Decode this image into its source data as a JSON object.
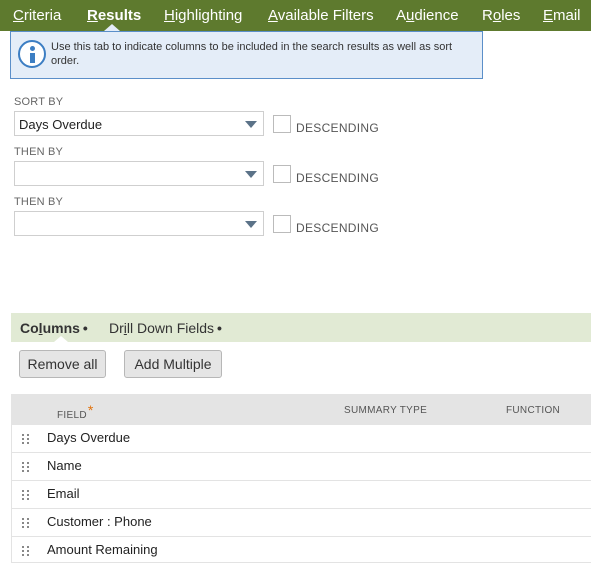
{
  "top_tabs": [
    {
      "pre": "",
      "acc": "C",
      "post": "riteria"
    },
    {
      "pre": "",
      "acc": "R",
      "post": "esults"
    },
    {
      "pre": "",
      "acc": "H",
      "post": "ighlighting"
    },
    {
      "pre": "",
      "acc": "A",
      "post": "vailable Filters"
    },
    {
      "pre": "A",
      "acc": "u",
      "post": "dience"
    },
    {
      "pre": "R",
      "acc": "o",
      "post": "les"
    },
    {
      "pre": "",
      "acc": "E",
      "post": "mail"
    }
  ],
  "active_tab": "Results",
  "info": {
    "icon": "info-icon",
    "message": "Use this tab to indicate columns to be included in the search results as well as sort order."
  },
  "sort": [
    {
      "label": "SORT BY",
      "value": "Days Overdue",
      "descending_label": "DESCENDING",
      "descending": false
    },
    {
      "label": "THEN BY",
      "value": "",
      "descending_label": "DESCENDING",
      "descending": false
    },
    {
      "label": "THEN BY",
      "value": "",
      "descending_label": "DESCENDING",
      "descending": false
    }
  ],
  "subtabs": [
    {
      "pre": "Co",
      "acc": "l",
      "post": "umns",
      "bullet": "•"
    },
    {
      "pre": "Dr",
      "acc": "i",
      "post": "ll Down Fields",
      "bullet": "•"
    }
  ],
  "buttons": {
    "remove_all": "Remove all",
    "add_multiple": "Add Multiple"
  },
  "table": {
    "headers": {
      "field": "FIELD",
      "required_mark": "*",
      "summary_type": "SUMMARY TYPE",
      "function": "FUNCTION"
    },
    "rows": [
      "Days Overdue",
      "Name",
      "Email",
      "Customer : Phone",
      "Amount Remaining"
    ]
  },
  "colors": {
    "tab_bar": "#5e7a2e",
    "info_bg": "#e4edf8",
    "info_border": "#5b8fc9",
    "subtab_bg": "#e1ead4",
    "required": "#e2730e"
  }
}
